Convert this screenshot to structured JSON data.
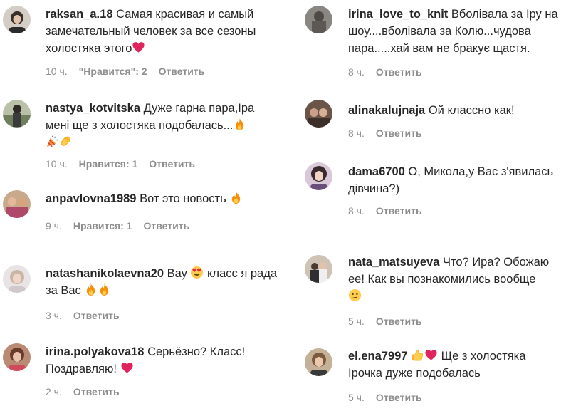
{
  "left": [
    {
      "user": "raksan_a.18",
      "text": "Самая красивая и самый замечательный человек за все сезоны холостяка этого",
      "time": "10 ч.",
      "likes": "\"Нравится\": 2",
      "reply": "Ответить"
    },
    {
      "user": "nastya_kotvitska",
      "text": "Дуже гарна пара,Іра мені ще з холостяка подобалась...",
      "time": "10 ч.",
      "likes": "Нравится: 1",
      "reply": "Ответить"
    },
    {
      "user": "anpavlovna1989",
      "text": "Вот это новость",
      "time": "9 ч.",
      "likes": "Нравится: 1",
      "reply": "Ответить"
    },
    {
      "user": "natashanikolaevna20",
      "text": "Вау",
      "text2": "класс я рада за Вас",
      "time": "3 ч.",
      "reply": "Ответить"
    },
    {
      "user": "irina.polyakova18",
      "text": "Серьёзно? Класс! Поздравляю!",
      "time": "2 ч.",
      "reply": "Ответить"
    }
  ],
  "right": [
    {
      "user": "irina_love_to_knit",
      "text": "Вболівала за Іру на шоу....вболівала за Колю...чудова пара.....хай вам не бракує щастя.",
      "time": "8 ч.",
      "reply": "Ответить"
    },
    {
      "user": "alinakalujnaja",
      "text": "Ой классно как!",
      "time": "8 ч.",
      "reply": "Ответить"
    },
    {
      "user": "dama6700",
      "text": "О, Микола,у Вас з'явилась дівчина?)",
      "time": "8 ч.",
      "reply": "Ответить"
    },
    {
      "user": "nata_matsuyeva",
      "text": "Что? Ира? Обожаю ее! Как вы познакомились вообще",
      "time": "5 ч.",
      "reply": "Ответить"
    },
    {
      "user": "el.ena7997",
      "text": "Ще з холостяка Ірочка дуже подобалась",
      "time": "5 ч.",
      "reply": "Ответить"
    }
  ],
  "icons": {
    "heart": "red-heart-icon",
    "fire": "fire-icon",
    "clap": "clapping-hands-icon",
    "party": "party-popper-icon",
    "hearteyes": "heart-eyes-icon",
    "confused": "confused-face-icon",
    "thumb": "thumbs-up-icon"
  },
  "colors": {
    "text": "#262626",
    "meta": "#8e8e8e",
    "heart": "#e0245e",
    "fire": "#f4900c"
  }
}
